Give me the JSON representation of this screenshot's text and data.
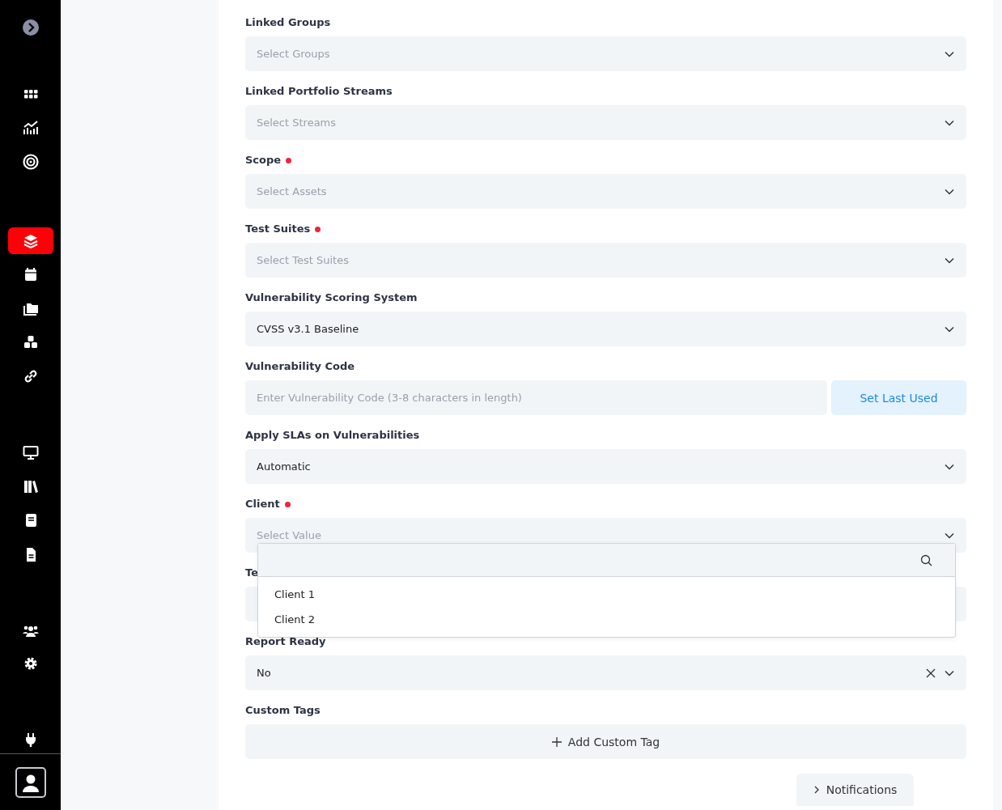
{
  "sidebar": {
    "items": [
      {
        "kind": "expand",
        "selected": false
      },
      {
        "kind": "grid",
        "selected": false
      },
      {
        "kind": "chart",
        "selected": false
      },
      {
        "kind": "target",
        "selected": false
      },
      {
        "kind": "layers",
        "selected": true
      },
      {
        "kind": "calendar",
        "selected": false
      },
      {
        "kind": "folders",
        "selected": false
      },
      {
        "kind": "cubes",
        "selected": false
      },
      {
        "kind": "link",
        "selected": false
      },
      {
        "kind": "monitor",
        "selected": false
      },
      {
        "kind": "books",
        "selected": false
      },
      {
        "kind": "book",
        "selected": false
      },
      {
        "kind": "document",
        "selected": false
      },
      {
        "kind": "team",
        "selected": false
      },
      {
        "kind": "gear",
        "selected": false
      },
      {
        "kind": "plug",
        "selected": false
      }
    ]
  },
  "form": {
    "fields": [
      {
        "label": "Linked Groups",
        "required": false,
        "kind": "select",
        "placeholder": "Select Groups"
      },
      {
        "label": "Linked Portfolio Streams",
        "required": false,
        "kind": "select",
        "placeholder": "Select Streams"
      },
      {
        "label": "Scope",
        "required": true,
        "kind": "select",
        "placeholder": "Select Assets"
      },
      {
        "label": "Test Suites",
        "required": true,
        "kind": "select",
        "placeholder": "Select Test Suites"
      },
      {
        "label": "Vulnerability Scoring System",
        "required": false,
        "kind": "select",
        "value": "CVSS v3.1 Baseline"
      },
      {
        "label": "Vulnerability Code",
        "required": false,
        "kind": "input",
        "placeholder": "Enter Vulnerability Code (3-8 characters in length)",
        "button": "Set Last Used"
      },
      {
        "label": "Apply SLAs on Vulnerabilities",
        "required": false,
        "kind": "select",
        "value": "Automatic"
      },
      {
        "label": "Client",
        "required": true,
        "kind": "select",
        "placeholder": "Select Value",
        "expanded": true,
        "options": [
          "Client 1",
          "Client 2"
        ]
      },
      {
        "label": "Te",
        "required": false,
        "kind": "select"
      },
      {
        "label": "Report Ready",
        "required": false,
        "kind": "select",
        "value": "No",
        "clearable": true
      },
      {
        "label": "Custom Tags",
        "required": false,
        "kind": "add",
        "button": "Add Custom Tag"
      }
    ]
  },
  "notifications": {
    "label": "Notifications"
  }
}
